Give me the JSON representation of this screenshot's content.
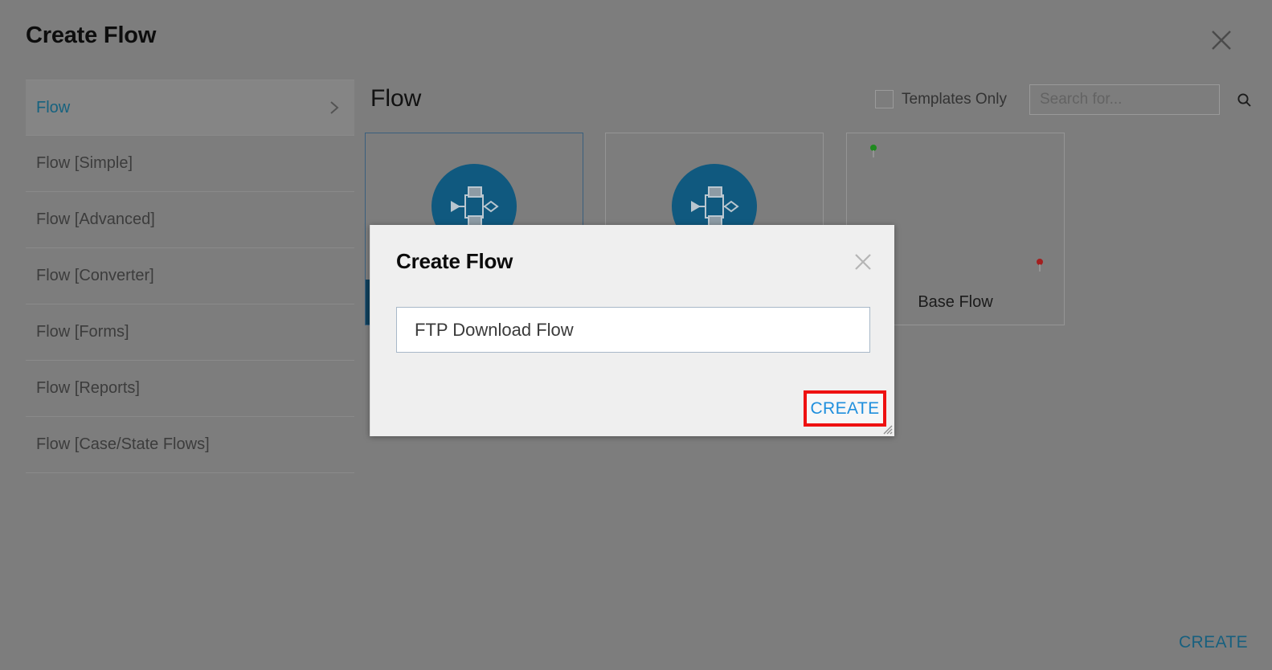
{
  "page": {
    "title": "Create Flow",
    "close_icon": "close-icon",
    "create_label": "CREATE"
  },
  "sidebar": {
    "items": [
      {
        "label": "Flow",
        "selected": true,
        "chevron": "chevron-right-icon"
      },
      {
        "label": "Flow [Simple]",
        "selected": false
      },
      {
        "label": "Flow [Advanced]",
        "selected": false
      },
      {
        "label": "Flow [Converter]",
        "selected": false
      },
      {
        "label": "Flow [Forms]",
        "selected": false
      },
      {
        "label": "Flow [Reports]",
        "selected": false
      },
      {
        "label": "Flow [Case/State Flows]",
        "selected": false
      }
    ]
  },
  "main": {
    "heading": "Flow",
    "templates_only": {
      "label": "Templates Only",
      "checked": false
    },
    "search": {
      "value": "",
      "placeholder": "Search for...",
      "icon": "search-icon"
    },
    "cards": [
      {
        "caption": "",
        "icon": "flow-icon",
        "selected": true,
        "has_band": true
      },
      {
        "caption": "",
        "icon": "flow-icon",
        "selected": false,
        "has_band": true
      },
      {
        "caption": "Base Flow",
        "icon": "flow-diagram-preview",
        "selected": false,
        "has_band": false
      }
    ]
  },
  "modal": {
    "title": "Create Flow",
    "close_icon": "close-icon",
    "name_input": {
      "value": "FTP Download Flow",
      "placeholder": ""
    },
    "create_label": "CREATE",
    "highlight_color": "#ee1111",
    "resize_handle": "resize-grip-icon"
  },
  "colors": {
    "accent_blue": "#17607f",
    "link_blue": "#1f8fdd",
    "icon_badge": "#10597f",
    "card_band": "#10405c",
    "backdrop": "#7d7d7d",
    "modal_bg": "#efefef"
  }
}
